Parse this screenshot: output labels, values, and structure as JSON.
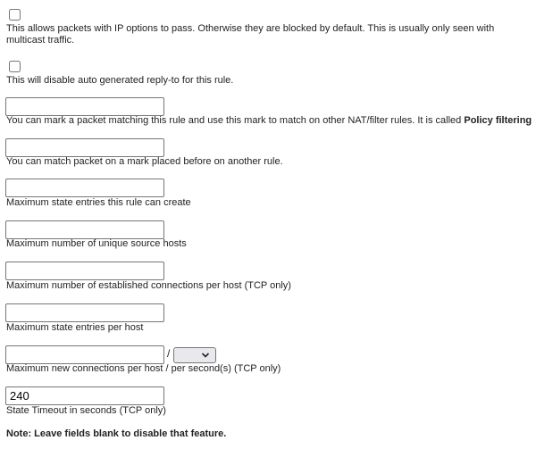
{
  "allow_opts": {
    "checked": false,
    "description": "This allows packets with IP options to pass. Otherwise they are blocked by default. This is usually only seen with multicast traffic."
  },
  "disable_replyto": {
    "checked": false,
    "description": "This will disable auto generated reply-to for this rule."
  },
  "tag": {
    "value": "",
    "description": "You can mark a packet matching this rule and use this mark to match on other NAT/filter rules. It is called",
    "description_bold": "Policy filtering"
  },
  "tagged": {
    "value": "",
    "description": "You can match packet on a mark placed before on another rule."
  },
  "max": {
    "value": "",
    "description": "Maximum state entries this rule can create"
  },
  "max_src_nodes": {
    "value": "",
    "description": "Maximum number of unique source hosts"
  },
  "max_src_conn": {
    "value": "",
    "description": "Maximum number of established connections per host (TCP only)"
  },
  "max_src_states": {
    "value": "",
    "description": "Maximum state entries per host"
  },
  "max_src_conn_rate": {
    "value": "",
    "separator": "/",
    "rates_selected": "",
    "description": "Maximum new connections per host / per second(s) (TCP only)"
  },
  "statetimeout": {
    "value": "240",
    "description": "State Timeout in seconds (TCP only)"
  },
  "note": "Note: Leave fields blank to disable that feature."
}
